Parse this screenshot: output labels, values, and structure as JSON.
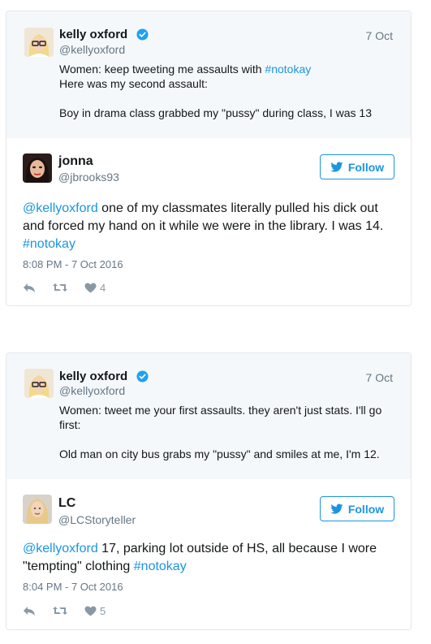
{
  "cards": [
    {
      "quoted": {
        "name": "kelly oxford",
        "handle": "@kellyoxford",
        "date": "7 Oct",
        "text": "Women: keep tweeting me assaults with ",
        "hashtag": "#notokay",
        "text2": "\nHere was my second assault:\n\nBoy in drama class grabbed my \"pussy\" during class, I was 13"
      },
      "reply": {
        "name": "jonna",
        "handle": "@jbrooks93",
        "follow_label": "Follow",
        "mention": "@kellyoxford",
        "body": " one of my classmates literally pulled his dick out and forced my hand on it while we were in the library. I was 14. ",
        "hashtag": "#notokay",
        "timestamp": "8:08 PM - 7 Oct 2016",
        "likes": "4"
      }
    },
    {
      "quoted": {
        "name": "kelly oxford",
        "handle": "@kellyoxford",
        "date": "7 Oct",
        "text": "Women: tweet me your first assaults. they aren't just stats. I'll go first:\n\nOld man on city bus grabs my \"pussy\" and smiles at me, I'm 12."
      },
      "reply": {
        "name": "LC",
        "handle": "@LCStoryteller",
        "follow_label": "Follow",
        "mention": "@kellyoxford",
        "body": " 17, parking lot outside of HS, all because I wore \"tempting\" clothing ",
        "hashtag": "#notokay",
        "timestamp": "8:04 PM - 7 Oct 2016",
        "likes": "5"
      }
    }
  ],
  "colors": {
    "link": "#1b95e0",
    "muted": "#657786",
    "quoted_bg": "#f5f8fa",
    "border": "#e1e8ed"
  },
  "icons": [
    "verified-icon",
    "twitter-bird-icon",
    "reply-icon",
    "retweet-icon",
    "heart-icon"
  ]
}
